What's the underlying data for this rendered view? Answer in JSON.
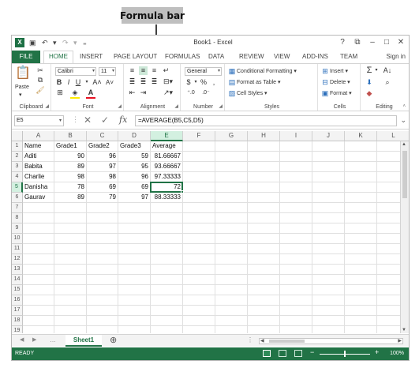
{
  "annotation": {
    "label": "Formula bar"
  },
  "window": {
    "title": "Book1 - Excel",
    "app_icon": "excel-icon",
    "controls": {
      "help": "?",
      "restore": "⧉",
      "minimize": "–",
      "maximize": "□",
      "close": "✕"
    }
  },
  "ribbon": {
    "file_tab": "FILE",
    "tabs": [
      "HOME",
      "INSERT",
      "PAGE LAYOUT",
      "FORMULAS",
      "DATA",
      "REVIEW",
      "VIEW",
      "ADD-INS",
      "TEAM"
    ],
    "active_tab": "HOME",
    "sign_in": "Sign in",
    "clipboard": {
      "label": "Clipboard",
      "paste": "Paste"
    },
    "font": {
      "label": "Font",
      "name": "Calibri",
      "size": "11",
      "bold": "B",
      "italic": "I",
      "underline": "U"
    },
    "alignment": {
      "label": "Alignment"
    },
    "number": {
      "label": "Number",
      "format": "General",
      "currency": "$",
      "percent": "%",
      "comma": ","
    },
    "styles": {
      "label": "Styles",
      "conditional": "Conditional Formatting",
      "format_table": "Format as Table",
      "cell_styles": "Cell Styles"
    },
    "cells": {
      "label": "Cells",
      "insert": "Insert",
      "delete": "Delete",
      "format": "Format"
    },
    "editing": {
      "label": "Editing",
      "sum": "Σ"
    }
  },
  "formula_bar": {
    "name_box": "E5",
    "cancel": "✕",
    "enter": "✓",
    "fx": "fx",
    "formula": "=AVERAGE(B5,C5,D5)"
  },
  "grid": {
    "columns": [
      "A",
      "B",
      "C",
      "D",
      "E",
      "F",
      "G",
      "H",
      "I",
      "J",
      "K",
      "L"
    ],
    "selected_column": "E",
    "row_numbers": [
      "1",
      "2",
      "3",
      "4",
      "5",
      "6",
      "7",
      "8",
      "9",
      "10",
      "11",
      "12",
      "13",
      "14",
      "15",
      "16",
      "17",
      "18",
      "19"
    ],
    "selected_row": "5",
    "header_row": [
      "Name",
      "Grade1",
      "Grade2",
      "Grade3",
      "Average"
    ],
    "rows": [
      [
        "Aditi",
        "90",
        "96",
        "59",
        "81.66667"
      ],
      [
        "Babita",
        "89",
        "97",
        "95",
        "93.66667"
      ],
      [
        "Charlie",
        "98",
        "98",
        "96",
        "97.33333"
      ],
      [
        "Danisha",
        "78",
        "69",
        "69",
        "72"
      ],
      [
        "Gaurav",
        "89",
        "79",
        "97",
        "88.33333"
      ]
    ]
  },
  "sheets": {
    "tabs": [
      "Sheet1"
    ],
    "add": "⊕"
  },
  "status": {
    "ready": "READY",
    "zoom": "100%"
  }
}
